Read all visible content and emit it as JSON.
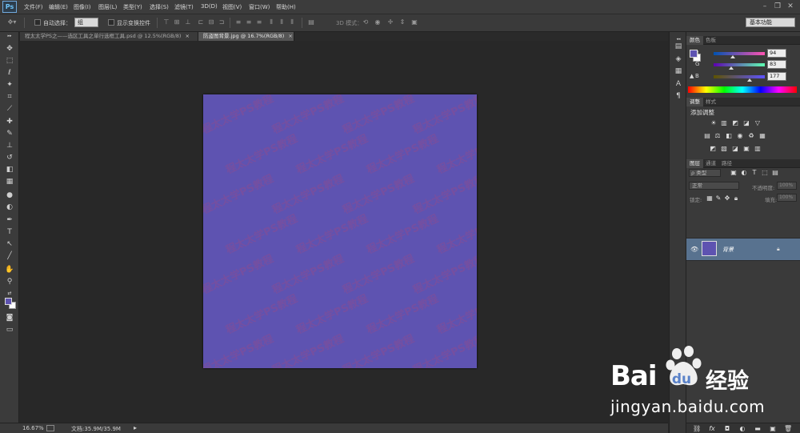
{
  "app": {
    "logo": "Ps"
  },
  "menubar": {
    "items": [
      "文件(F)",
      "编辑(E)",
      "图像(I)",
      "图层(L)",
      "类型(Y)",
      "选择(S)",
      "滤镜(T)",
      "3D(D)",
      "视图(V)",
      "窗口(W)",
      "帮助(H)"
    ],
    "window_controls": [
      "minimize-icon",
      "restore-icon",
      "close-icon"
    ]
  },
  "options_bar": {
    "auto_select_label": "自动选择：",
    "auto_select_value": "组",
    "show_transform_label": "显示变换控件",
    "mode_3d_label": "3D 模式：",
    "workspace": "基本功能"
  },
  "tabs": [
    {
      "title": "程太太学PS之——选区工具之单行选框工具.psd @ 12.5%(RGB/8)",
      "active": false
    },
    {
      "title": "防盗图背景.jpg @ 16.7%(RGB/8)",
      "active": true
    }
  ],
  "tab_close_glyph": "×",
  "canvas": {
    "background": "#5e53b1",
    "watermark_text": "程太太学PS教程",
    "watermark_color": "#7a4f9e"
  },
  "status": {
    "zoom": "16.67%",
    "doc_info": "文档:35.9M/35.9M"
  },
  "color_panel": {
    "tabs": [
      "颜色",
      "色板"
    ],
    "r_label": "R",
    "g_label": "G",
    "b_label": "B",
    "r": "94",
    "g": "83",
    "b": "177",
    "foreground": "#5e53b1",
    "background": "#ffffff"
  },
  "adjustments_panel": {
    "tabs": [
      "调整",
      "样式"
    ],
    "heading": "添加调整",
    "icons": [
      "brightness-icon",
      "levels-icon",
      "curves-icon",
      "exposure-icon",
      "vibrance-icon",
      "hue-saturation-icon",
      "color-balance-icon",
      "black-white-icon",
      "photo-filter-icon",
      "channel-mixer-icon",
      "color-lookup-icon",
      "invert-icon",
      "posterize-icon",
      "threshold-icon",
      "selective-color-icon",
      "gradient-map-icon"
    ]
  },
  "layers_panel": {
    "tabs": [
      "图层",
      "通道",
      "路径"
    ],
    "kind_filter": "ρ 类型",
    "blend_mode": "正常",
    "opacity_label": "不透明度:",
    "opacity_value": "100%",
    "lock_label": "锁定:",
    "fill_label": "填充:",
    "fill_value": "100%",
    "layer_name": "背景"
  },
  "baidu_watermark": {
    "brand": "Bai",
    "brand2": "du",
    "cn": "经验",
    "url": "jingyan.baidu.com"
  }
}
